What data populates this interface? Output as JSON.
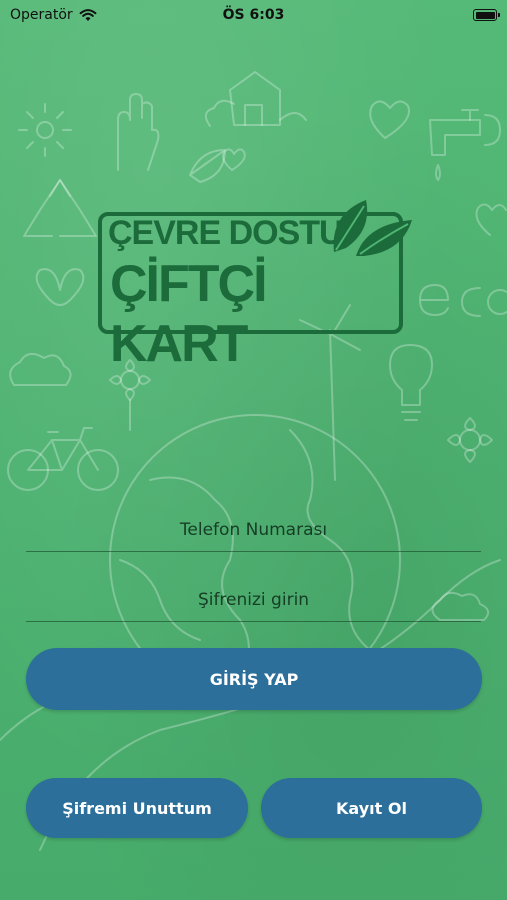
{
  "status_bar": {
    "carrier": "Operatör",
    "time": "ÖS 6:03"
  },
  "logo": {
    "line1": "ÇEVRE DOSTU",
    "line2": "ÇİFTÇİ KART"
  },
  "form": {
    "phone_placeholder": "Telefon Numarası",
    "password_placeholder": "Şifrenizi girin"
  },
  "buttons": {
    "login": "GİRİŞ YAP",
    "forgot_password": "Şifremi Unuttum",
    "register": "Kayıt Ol"
  },
  "colors": {
    "background": "#4fb572",
    "button": "#2b6f9a",
    "logo": "#1c6b3a"
  }
}
